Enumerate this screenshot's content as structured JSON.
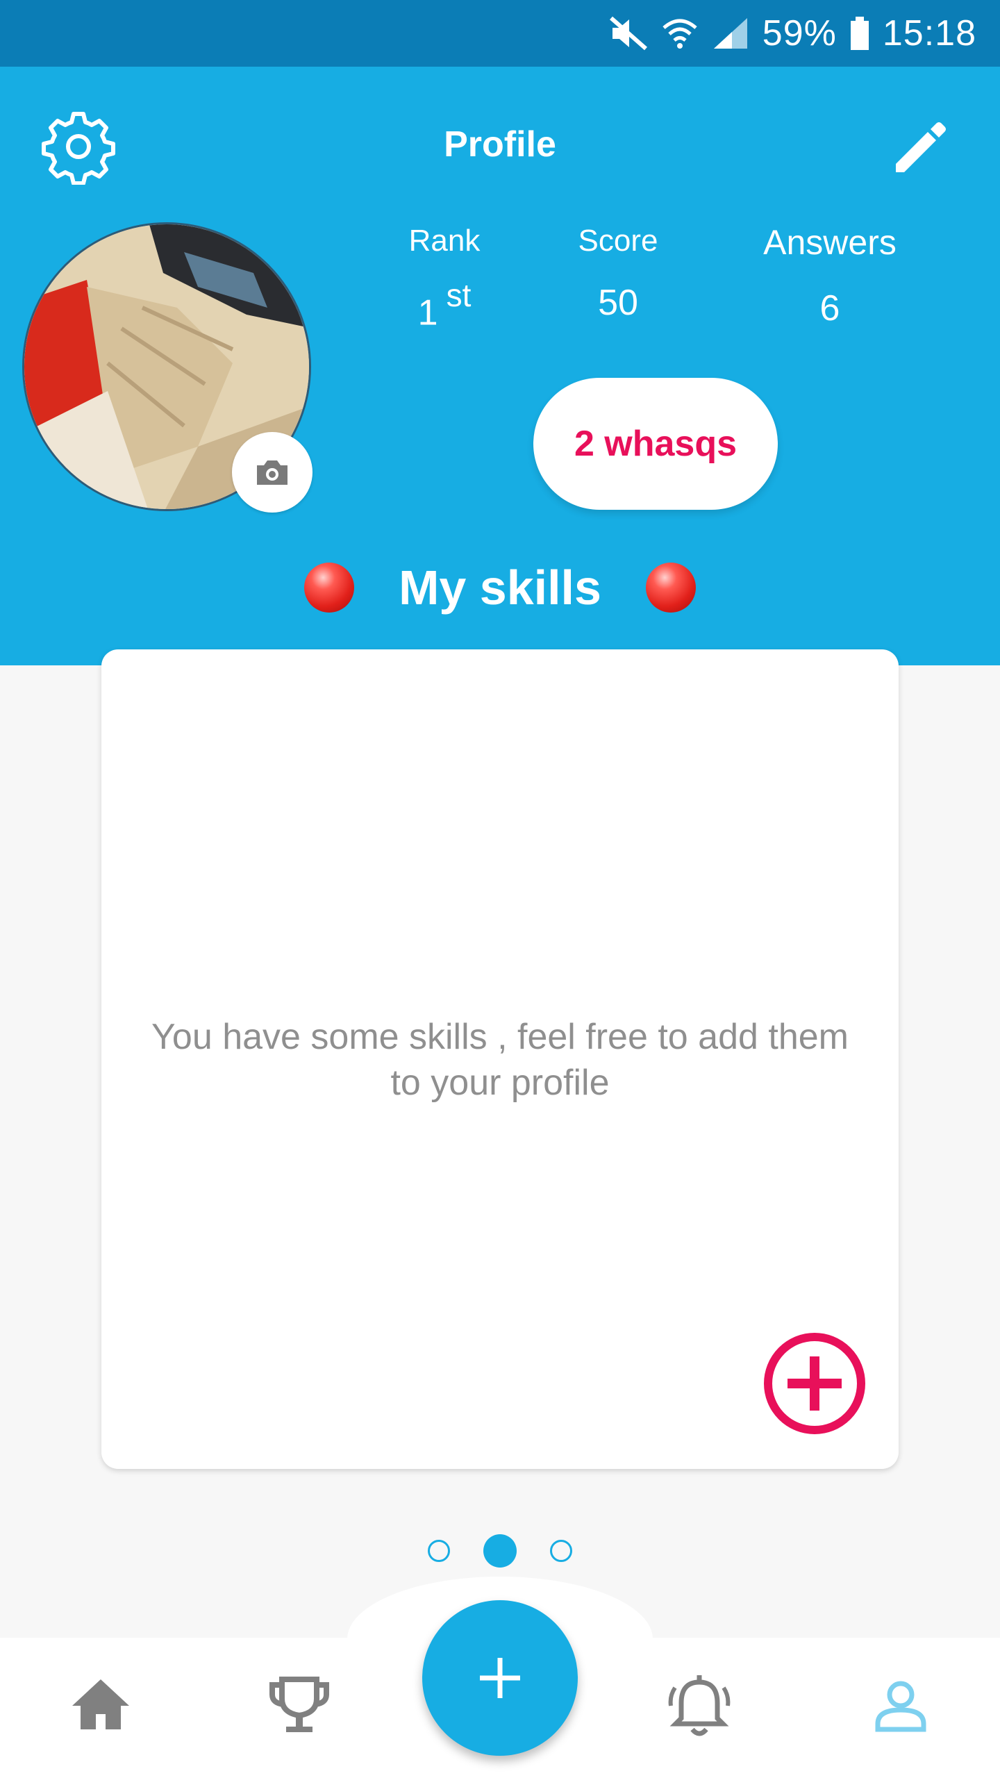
{
  "status_bar": {
    "battery": "59%",
    "time": "15:18",
    "icons": [
      "mute-icon",
      "wifi-icon",
      "signal-icon",
      "battery-icon"
    ]
  },
  "header": {
    "title": "Profile",
    "settings_icon": "gear-icon",
    "edit_icon": "pencil-icon"
  },
  "stats": {
    "rank": {
      "label": "Rank",
      "value": "1",
      "suffix": "st"
    },
    "score": {
      "label": "Score",
      "value": "50"
    },
    "answers": {
      "label": "Answers",
      "value": "6"
    }
  },
  "whasqs_button": "2 whasqs",
  "skills": {
    "title": "My skills",
    "empty_message": "You have some skills , feel free to add them to your profile"
  },
  "pager": {
    "count": 3,
    "active_index": 1
  },
  "bottom_nav": {
    "items": [
      "home-icon",
      "trophy-icon",
      "add-icon",
      "bell-icon",
      "profile-icon"
    ],
    "active": "profile-icon"
  },
  "colors": {
    "primary": "#17ade3",
    "status_bar": "#0b7db6",
    "accent": "#e8105a",
    "muted_text": "#8f8f8f",
    "nav_inactive": "#808080"
  }
}
